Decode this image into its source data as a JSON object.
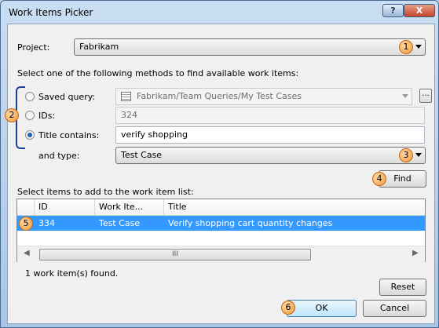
{
  "window": {
    "title": "Work Items Picker",
    "help_glyph": "?",
    "close_glyph": "X"
  },
  "project": {
    "label": "Project:",
    "value": "Fabrikam",
    "callout": "1"
  },
  "instructions": "Select one of the following methods to find available work items:",
  "methods": {
    "callout": "2",
    "saved_query": {
      "label": "Saved query:",
      "value": "Fabrikam/Team Queries/My Test Cases",
      "browse_label": "...",
      "icon": "query-icon"
    },
    "ids": {
      "label": "IDs:",
      "value": "324"
    },
    "title_contains": {
      "label": "Title contains:",
      "value": "verify shopping",
      "selected": true
    },
    "and_type": {
      "label": "and type:",
      "value": "Test Case",
      "callout": "3"
    }
  },
  "find": {
    "label": "Find",
    "callout": "4"
  },
  "grid": {
    "caption": "Select items to add to the work item list:",
    "columns": [
      "ID",
      "Work Ite...",
      "Title"
    ],
    "rows": [
      {
        "id": "334",
        "work_item_type": "Test Case",
        "title": "Verify shopping cart quantity changes",
        "selected": true,
        "callout": "5"
      }
    ],
    "scroll_left": "◀",
    "scroll_right": "▶",
    "thumb_grip": "III"
  },
  "status": "1 work item(s) found.",
  "buttons": {
    "reset": "Reset",
    "ok": "OK",
    "ok_callout": "6",
    "cancel": "Cancel"
  },
  "colors": {
    "selection": "#3399ff",
    "callout": "#f2993a",
    "bracket": "#1f3f9a"
  }
}
